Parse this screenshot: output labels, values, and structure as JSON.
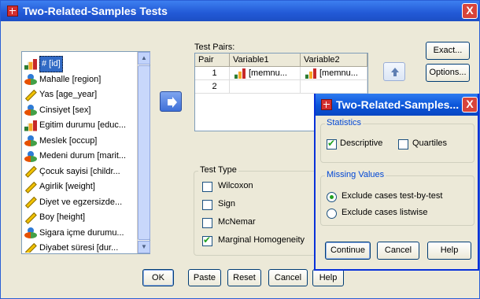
{
  "window": {
    "title": "Two-Related-Samples Tests",
    "close": "X"
  },
  "variables": [
    {
      "label": "# [id]",
      "icon": "scale-icon",
      "selected": true
    },
    {
      "label": "Mahalle [region]",
      "icon": "nominal-icon"
    },
    {
      "label": "Yas [age_year]",
      "icon": "ruler-icon"
    },
    {
      "label": "Cinsiyet [sex]",
      "icon": "nominal-icon"
    },
    {
      "label": "Egitim durumu [educ...",
      "icon": "scale-icon"
    },
    {
      "label": "Meslek [occup]",
      "icon": "nominal-icon"
    },
    {
      "label": "Medeni durum [marit...",
      "icon": "nominal-icon"
    },
    {
      "label": "Çocuk sayisi [childr...",
      "icon": "ruler-icon"
    },
    {
      "label": "Agirlik [weight]",
      "icon": "ruler-icon"
    },
    {
      "label": "Diyet ve egzersizde...",
      "icon": "ruler-icon"
    },
    {
      "label": "Boy [height]",
      "icon": "ruler-icon"
    },
    {
      "label": "Sigara içme durumu...",
      "icon": "nominal-icon"
    },
    {
      "label": "Diyabet süresi [dur...",
      "icon": "ruler-icon"
    }
  ],
  "test_pairs": {
    "label": "Test Pairs:",
    "columns": [
      "Pair",
      "Variable1",
      "Variable2"
    ],
    "rows": [
      {
        "pair": "1",
        "var1": "[memnu...",
        "var2": "[memnu..."
      },
      {
        "pair": "2",
        "var1": "",
        "var2": ""
      }
    ]
  },
  "side_buttons": {
    "exact": "Exact...",
    "options": "Options..."
  },
  "test_type": {
    "label": "Test Type",
    "items": [
      {
        "label": "Wilcoxon",
        "checked": false
      },
      {
        "label": "Sign",
        "checked": false
      },
      {
        "label": "McNemar",
        "checked": false
      },
      {
        "label": "Marginal Homogeneity",
        "checked": true
      }
    ]
  },
  "bottom_buttons": {
    "ok": "OK",
    "paste": "Paste",
    "reset": "Reset",
    "cancel": "Cancel",
    "help": "Help"
  },
  "options_dialog": {
    "title": "Two-Related-Samples...",
    "close": "X",
    "statistics": {
      "label": "Statistics",
      "descriptive": {
        "label": "Descriptive",
        "checked": true
      },
      "quartiles": {
        "label": "Quartiles",
        "checked": false
      }
    },
    "missing_values": {
      "label": "Missing Values",
      "options": [
        {
          "label": "Exclude cases test-by-test",
          "selected": true
        },
        {
          "label": "Exclude cases listwise",
          "selected": false
        }
      ]
    },
    "buttons": {
      "continue": "Continue",
      "cancel": "Cancel",
      "help": "Help"
    }
  },
  "colors": {
    "titlebar": "#2259d6",
    "dialog_bg": "#ece9d8",
    "selection": "#316ac5",
    "check": "#21a121"
  }
}
